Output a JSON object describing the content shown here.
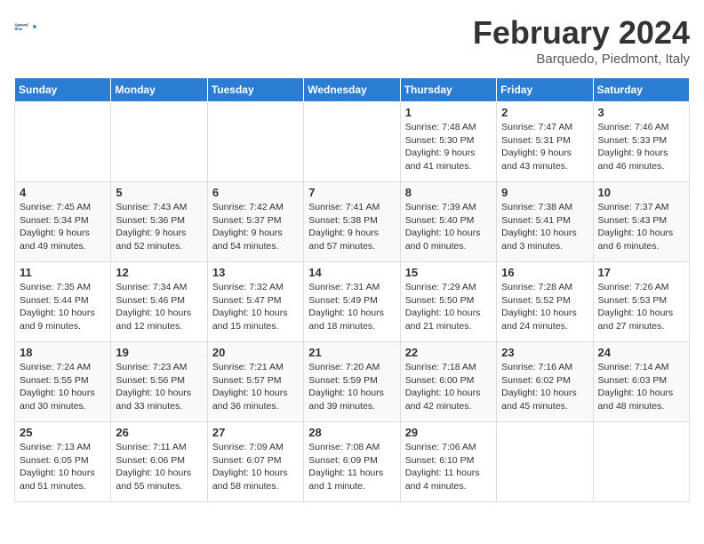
{
  "header": {
    "logo_line1": "General",
    "logo_line2": "Blue",
    "month_title": "February 2024",
    "location": "Barquedo, Piedmont, Italy"
  },
  "days_of_week": [
    "Sunday",
    "Monday",
    "Tuesday",
    "Wednesday",
    "Thursday",
    "Friday",
    "Saturday"
  ],
  "weeks": [
    [
      {
        "day": "",
        "info": ""
      },
      {
        "day": "",
        "info": ""
      },
      {
        "day": "",
        "info": ""
      },
      {
        "day": "",
        "info": ""
      },
      {
        "day": "1",
        "info": "Sunrise: 7:48 AM\nSunset: 5:30 PM\nDaylight: 9 hours\nand 41 minutes."
      },
      {
        "day": "2",
        "info": "Sunrise: 7:47 AM\nSunset: 5:31 PM\nDaylight: 9 hours\nand 43 minutes."
      },
      {
        "day": "3",
        "info": "Sunrise: 7:46 AM\nSunset: 5:33 PM\nDaylight: 9 hours\nand 46 minutes."
      }
    ],
    [
      {
        "day": "4",
        "info": "Sunrise: 7:45 AM\nSunset: 5:34 PM\nDaylight: 9 hours\nand 49 minutes."
      },
      {
        "day": "5",
        "info": "Sunrise: 7:43 AM\nSunset: 5:36 PM\nDaylight: 9 hours\nand 52 minutes."
      },
      {
        "day": "6",
        "info": "Sunrise: 7:42 AM\nSunset: 5:37 PM\nDaylight: 9 hours\nand 54 minutes."
      },
      {
        "day": "7",
        "info": "Sunrise: 7:41 AM\nSunset: 5:38 PM\nDaylight: 9 hours\nand 57 minutes."
      },
      {
        "day": "8",
        "info": "Sunrise: 7:39 AM\nSunset: 5:40 PM\nDaylight: 10 hours\nand 0 minutes."
      },
      {
        "day": "9",
        "info": "Sunrise: 7:38 AM\nSunset: 5:41 PM\nDaylight: 10 hours\nand 3 minutes."
      },
      {
        "day": "10",
        "info": "Sunrise: 7:37 AM\nSunset: 5:43 PM\nDaylight: 10 hours\nand 6 minutes."
      }
    ],
    [
      {
        "day": "11",
        "info": "Sunrise: 7:35 AM\nSunset: 5:44 PM\nDaylight: 10 hours\nand 9 minutes."
      },
      {
        "day": "12",
        "info": "Sunrise: 7:34 AM\nSunset: 5:46 PM\nDaylight: 10 hours\nand 12 minutes."
      },
      {
        "day": "13",
        "info": "Sunrise: 7:32 AM\nSunset: 5:47 PM\nDaylight: 10 hours\nand 15 minutes."
      },
      {
        "day": "14",
        "info": "Sunrise: 7:31 AM\nSunset: 5:49 PM\nDaylight: 10 hours\nand 18 minutes."
      },
      {
        "day": "15",
        "info": "Sunrise: 7:29 AM\nSunset: 5:50 PM\nDaylight: 10 hours\nand 21 minutes."
      },
      {
        "day": "16",
        "info": "Sunrise: 7:28 AM\nSunset: 5:52 PM\nDaylight: 10 hours\nand 24 minutes."
      },
      {
        "day": "17",
        "info": "Sunrise: 7:26 AM\nSunset: 5:53 PM\nDaylight: 10 hours\nand 27 minutes."
      }
    ],
    [
      {
        "day": "18",
        "info": "Sunrise: 7:24 AM\nSunset: 5:55 PM\nDaylight: 10 hours\nand 30 minutes."
      },
      {
        "day": "19",
        "info": "Sunrise: 7:23 AM\nSunset: 5:56 PM\nDaylight: 10 hours\nand 33 minutes."
      },
      {
        "day": "20",
        "info": "Sunrise: 7:21 AM\nSunset: 5:57 PM\nDaylight: 10 hours\nand 36 minutes."
      },
      {
        "day": "21",
        "info": "Sunrise: 7:20 AM\nSunset: 5:59 PM\nDaylight: 10 hours\nand 39 minutes."
      },
      {
        "day": "22",
        "info": "Sunrise: 7:18 AM\nSunset: 6:00 PM\nDaylight: 10 hours\nand 42 minutes."
      },
      {
        "day": "23",
        "info": "Sunrise: 7:16 AM\nSunset: 6:02 PM\nDaylight: 10 hours\nand 45 minutes."
      },
      {
        "day": "24",
        "info": "Sunrise: 7:14 AM\nSunset: 6:03 PM\nDaylight: 10 hours\nand 48 minutes."
      }
    ],
    [
      {
        "day": "25",
        "info": "Sunrise: 7:13 AM\nSunset: 6:05 PM\nDaylight: 10 hours\nand 51 minutes."
      },
      {
        "day": "26",
        "info": "Sunrise: 7:11 AM\nSunset: 6:06 PM\nDaylight: 10 hours\nand 55 minutes."
      },
      {
        "day": "27",
        "info": "Sunrise: 7:09 AM\nSunset: 6:07 PM\nDaylight: 10 hours\nand 58 minutes."
      },
      {
        "day": "28",
        "info": "Sunrise: 7:08 AM\nSunset: 6:09 PM\nDaylight: 11 hours\nand 1 minute."
      },
      {
        "day": "29",
        "info": "Sunrise: 7:06 AM\nSunset: 6:10 PM\nDaylight: 11 hours\nand 4 minutes."
      },
      {
        "day": "",
        "info": ""
      },
      {
        "day": "",
        "info": ""
      }
    ]
  ]
}
